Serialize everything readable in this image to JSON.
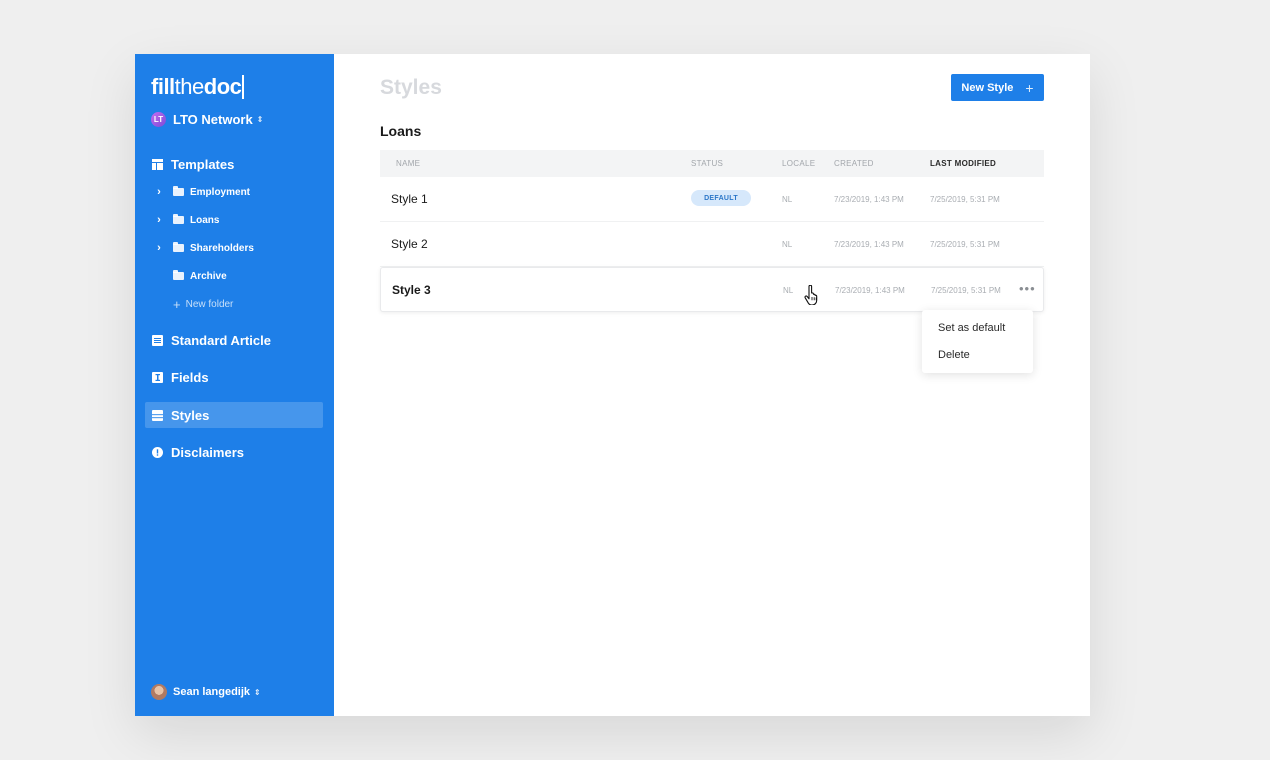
{
  "brand": {
    "logo_bold1": "fill",
    "logo_light": "the",
    "logo_bold2": "doc"
  },
  "org": {
    "name": "LTO Network",
    "logo_text": "LT"
  },
  "sidebar": {
    "templates_label": "Templates",
    "folders": [
      "Employment",
      "Loans",
      "Shareholders"
    ],
    "archive_label": "Archive",
    "new_folder_label": "New folder",
    "standard_article_label": "Standard Article",
    "fields_label": "Fields",
    "styles_label": "Styles",
    "disclaimers_label": "Disclaimers"
  },
  "user": {
    "name": "Sean langedijk"
  },
  "page": {
    "title": "Styles",
    "new_button": "New Style",
    "new_button_icon": "+",
    "section": "Loans"
  },
  "table": {
    "headers": {
      "name": "NAME",
      "status": "STATUS",
      "locale": "LOCALE",
      "created": "CREATED",
      "last_modified": "LAST MODIFIED"
    },
    "rows": [
      {
        "name": "Style 1",
        "status": "DEFAULT",
        "locale": "NL",
        "created": "7/23/2019, 1:43 PM",
        "modified": "7/25/2019, 5:31 PM"
      },
      {
        "name": "Style 2",
        "status": "",
        "locale": "NL",
        "created": "7/23/2019, 1:43 PM",
        "modified": "7/25/2019, 5:31 PM"
      },
      {
        "name": "Style 3",
        "status": "",
        "locale": "NL",
        "created": "7/23/2019, 1:43 PM",
        "modified": "7/25/2019, 5:31 PM"
      }
    ],
    "more_icon": "•••"
  },
  "context_menu": {
    "set_default": "Set as default",
    "delete": "Delete"
  },
  "colors": {
    "accent": "#1e7fe8",
    "badge_bg": "#d6e8fb",
    "badge_text": "#2a76c8"
  }
}
